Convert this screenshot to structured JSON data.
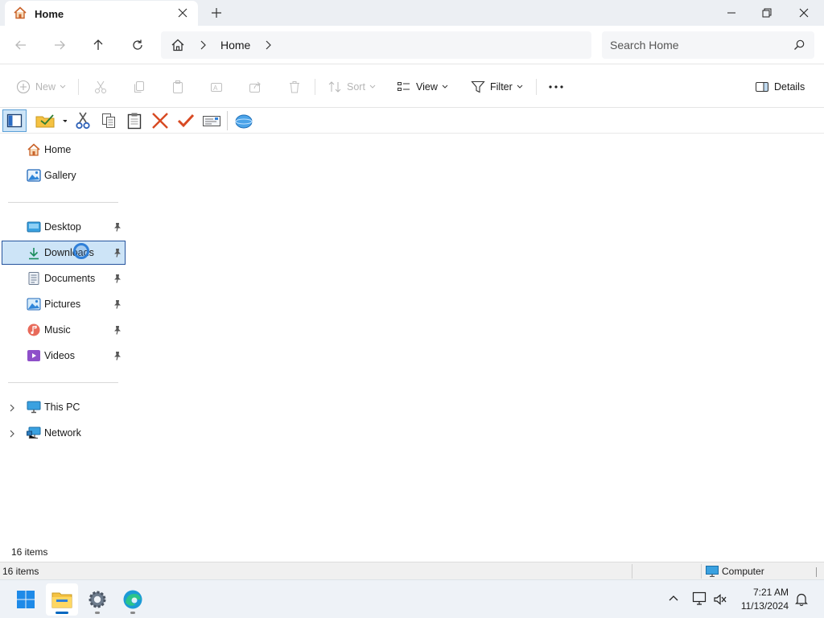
{
  "window": {
    "tab_title": "Home",
    "controls": {
      "minimize": "minimize",
      "maximize": "restore",
      "close": "close"
    }
  },
  "address": {
    "breadcrumb_label": "Home",
    "search_placeholder": "Search Home"
  },
  "commands": {
    "new": "New",
    "sort": "Sort",
    "view": "View",
    "filter": "Filter",
    "details": "Details"
  },
  "nav": {
    "top": [
      {
        "label": "Home",
        "icon": "home-icon"
      },
      {
        "label": "Gallery",
        "icon": "gallery-icon"
      }
    ],
    "pinned": [
      {
        "label": "Desktop",
        "icon": "desktop-folder-icon",
        "pinned": true
      },
      {
        "label": "Downloads",
        "icon": "downloads-folder-icon",
        "pinned": true,
        "selected": true
      },
      {
        "label": "Documents",
        "icon": "documents-folder-icon",
        "pinned": true
      },
      {
        "label": "Pictures",
        "icon": "pictures-folder-icon",
        "pinned": true
      },
      {
        "label": "Music",
        "icon": "music-folder-icon",
        "pinned": true
      },
      {
        "label": "Videos",
        "icon": "videos-folder-icon",
        "pinned": true
      }
    ],
    "devices": [
      {
        "label": "This PC",
        "icon": "this-pc-icon"
      },
      {
        "label": "Network",
        "icon": "network-icon"
      }
    ]
  },
  "status": {
    "pane_items": "16 items",
    "bar_items": "16 items",
    "computer": "Computer"
  },
  "taskbar": {
    "apps": [
      "start-icon",
      "file-explorer-icon",
      "settings-icon",
      "edge-icon"
    ],
    "time": "7:21 AM",
    "date": "11/13/2024"
  },
  "colors": {
    "accent": "#0067c0",
    "selection": "#cde4f7",
    "folder": "#f5c242"
  }
}
